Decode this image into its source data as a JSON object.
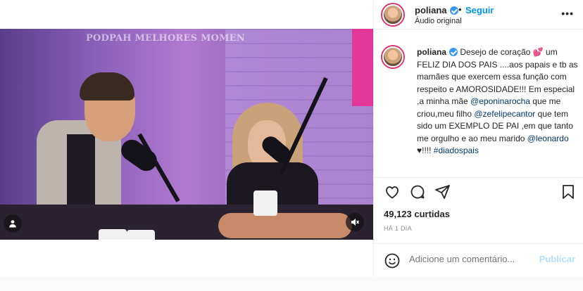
{
  "post": {
    "username": "poliana",
    "follow_label": "Seguir",
    "separator": "•",
    "audio_label": "Áudio original",
    "more_label": "•••"
  },
  "video": {
    "watermark": "PODPAH MELHORES MOMEN"
  },
  "caption": {
    "username": "poliana",
    "part1": " Desejo de coração 💕 um FELIZ DIA DOS PAIS ....aos papais e tb as mamães que exercem essa função com respeito e AMOROSIDADE!!! Em especial ,a minha mãe ",
    "mention1": "@eponinarocha",
    "part2": " que me criou,meu filho ",
    "mention2": "@zefelipecantor",
    "part3": " que tem sido um EXEMPLO DE PAI ,em que tanto me orgulho e ao meu marido ",
    "mention3": "@leonardo",
    "part4": " ♥!!!! ",
    "hashtag": "#diadospais"
  },
  "stats": {
    "likes": "49,123 curtidas",
    "time_ago": "HÁ 1 DIA"
  },
  "comment": {
    "placeholder": "Adicione um comentário...",
    "publish_label": "Publicar"
  },
  "colors": {
    "accent": "#0095f6",
    "verified": "#3897f0",
    "publish_disabled": "#b2dffc"
  }
}
